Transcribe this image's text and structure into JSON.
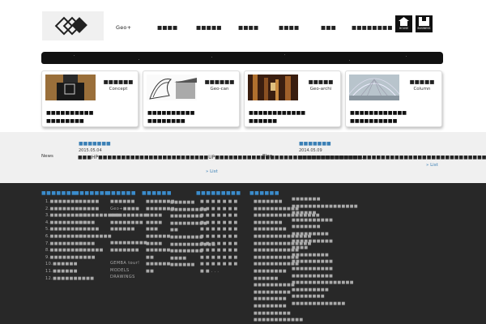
{
  "header": {
    "nav": [
      "Geo+",
      "■■■■",
      "■■■■■",
      "■■■■",
      "■■■■",
      "■■■",
      "■■■■■■■■"
    ],
    "buttons": [
      {
        "label": "HOUSE"
      },
      {
        "label": "BUSINESS"
      }
    ]
  },
  "cards": [
    {
      "title": "■■■■■■",
      "subtitle": "Concept",
      "desc1": "■■■■■■■■■■",
      "desc2": "■■■■■■■■"
    },
    {
      "title": "■■■■■■",
      "subtitle": "Geo-can",
      "desc1": "■■■■■■■■■■",
      "desc2": "■■■■■■■■"
    },
    {
      "title": "■■■■■",
      "subtitle": "Geo-archi",
      "desc1": "■■■■■■■■■■■■",
      "desc2": "■■■■■■"
    },
    {
      "title": "■■■■■",
      "subtitle": "Column",
      "desc1": "■■■■■■■■■■■■",
      "desc2": "■■■■■■■■■■"
    }
  ],
  "news": {
    "label": "News",
    "title": "■■■■■■■",
    "date": "2015.05.04",
    "text": "■■■HP■■■■■■■■■■■■■■■■■■■■■■■■UP■■■■■■■■■■■■■■■■■■■■■■■■■■■■■■■■...",
    "more": "» List"
  },
  "blog": {
    "label": "Blog",
    "title": "■■■■■■■",
    "date": "2014.05.09",
    "text": "■■■■■■■■■■■■■■■■■■■■■■■■■■■■■■■■■■■■■■■■■■■...",
    "more": "» List"
  },
  "footer": {
    "col1": {
      "head": "■■■■■■■",
      "items": [
        "1.■■■■■■■",
        "2.■■■■■■■",
        "3.■■■■■■■■■",
        "4.■■■■■■■■■",
        "5.■■■■■■■",
        "6.■■■■■■■■",
        "7.■■■■■■■■",
        "8.■■■■■■■■",
        "9.■■■■■■■■■■■",
        "10.■■■■■■",
        "11.■■■■■■",
        "12.■■■■■■■■■■"
      ]
    },
    "col2": {
      "head": "■■■■■■■",
      "items": [
        "■■■■■",
        "■■■■■",
        "■■■■■■■■■■",
        "■■■■",
        "■■■■■",
        "■■■■■■■■",
        "■■■■",
        "■■■■■■"
      ]
    },
    "col3": {
      "head": "■■■■■■",
      "items": [
        "■■■■■■",
        "Geo+■■■■",
        "■■■■■■■■■",
        "■■■■■■■■",
        "■■■■■■",
        "",
        "■■■■■■■■■",
        "■■■■■■■",
        "",
        "GEMBA tour!",
        "MODELS",
        "DRAWINGS"
      ]
    },
    "col4": {
      "head": "■■■■■■",
      "items": [
        "■■■■■■■",
        "■■■■■■■",
        "■■■■",
        "■■■■",
        "■■■",
        "■■■■■■",
        "■■■■",
        "■■■■■■",
        "■■",
        "■■■■■■",
        "■■"
      ]
    },
    "col5": {
      "items": [
        "■■■■■■",
        "■■■■■■■■■",
        "■■■■■■■■",
        "■■■■■■■■■",
        "■■",
        "■■■■■■■■",
        "■■■■■■■■■■■",
        "■■■■■■■■",
        "■■■■",
        "■■■■■■"
      ]
    },
    "col6": {
      "head": "■■■■■■■■■",
      "grid": "■■■■■■■■■■■■■■■■■■■■■■■■■■■■■■■■■■■■■■■■■■■■■■■■■■■■■■■■■■■■■■■■■■■■■■■■..."
    },
    "col7": {
      "head": "■■■■■■",
      "items": [
        "■■■■■■■",
        "■■■■■■■■■■■",
        "■■■■■■■■■■■■■■■■",
        "■■■■■■■",
        "■■■■■■■■",
        "■■■■■■■■■■■■■■",
        "■■■■■■■■■■■■■■",
        "■■■■■■■■■■■",
        "■■■■■■■■■■■",
        "■■■■■■■■■■■",
        "■■■■■■■■",
        "■■■■■■",
        "■■■■■■■■■■",
        "■■■■■■■■■",
        "■■■■■■■■",
        "■■■■■■■■",
        "■■■■■■■■■",
        "■■■■■■■■■■■■",
        "■■■■■■■■"
      ]
    },
    "col8": {
      "items": [
        "■■■■■■■",
        "■■■■■■■■■■■■■■■■",
        "■■■■■■",
        "■■■■■■■■■■",
        "■■■■■■■",
        "■■■■■■■■■",
        "■■■■■■■■■■",
        "■■■■",
        "■■■■■■■■■",
        "■■■■■■■■■■",
        "■■■■■■■■■■",
        "■■■■■■■■■■",
        "■■■■■■■■■■■■■■■",
        "■■■■■■■■■",
        "■■■■■■■■",
        "■■■■■■■■■■■■■"
      ]
    }
  }
}
